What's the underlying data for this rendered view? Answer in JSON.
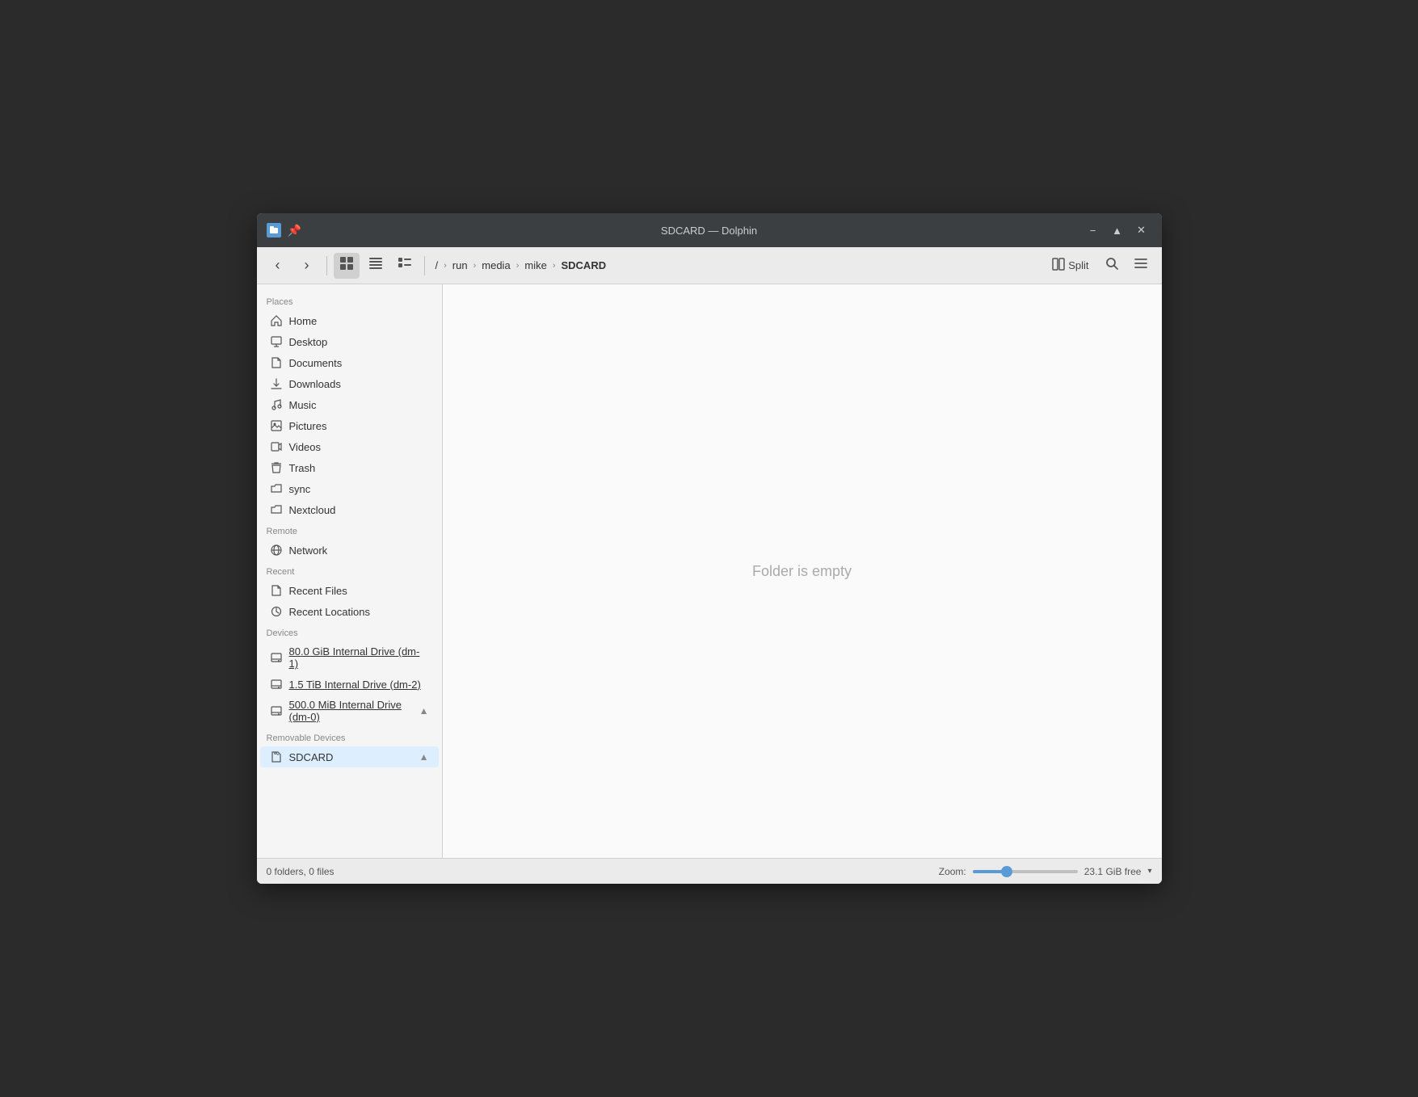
{
  "window": {
    "title": "SDCARD — Dolphin"
  },
  "titlebar": {
    "minimize_label": "−",
    "maximize_label": "▲",
    "close_label": "✕"
  },
  "toolbar": {
    "back_label": "‹",
    "forward_label": "›",
    "view_icons_label": "⊞",
    "view_compact_label": "▤",
    "view_details_label": "⊟",
    "split_label": "Split",
    "search_label": "🔍",
    "menu_label": "≡"
  },
  "breadcrumb": {
    "items": [
      {
        "label": "/",
        "id": "root"
      },
      {
        "label": "run",
        "id": "run"
      },
      {
        "label": "media",
        "id": "media"
      },
      {
        "label": "mike",
        "id": "mike"
      },
      {
        "label": "SDCARD",
        "id": "sdcard",
        "current": true
      }
    ]
  },
  "sidebar": {
    "places_header": "Places",
    "places_items": [
      {
        "id": "home",
        "label": "Home",
        "icon": "🏠"
      },
      {
        "id": "desktop",
        "label": "Desktop",
        "icon": "🖥"
      },
      {
        "id": "documents",
        "label": "Documents",
        "icon": "📄"
      },
      {
        "id": "downloads",
        "label": "Downloads",
        "icon": "📥"
      },
      {
        "id": "music",
        "label": "Music",
        "icon": "🎵"
      },
      {
        "id": "pictures",
        "label": "Pictures",
        "icon": "🖼"
      },
      {
        "id": "videos",
        "label": "Videos",
        "icon": "🎬"
      },
      {
        "id": "trash",
        "label": "Trash",
        "icon": "🗑"
      },
      {
        "id": "sync",
        "label": "sync",
        "icon": "📁"
      },
      {
        "id": "nextcloud",
        "label": "Nextcloud",
        "icon": "📁"
      }
    ],
    "remote_header": "Remote",
    "remote_items": [
      {
        "id": "network",
        "label": "Network",
        "icon": "🌐"
      }
    ],
    "recent_header": "Recent",
    "recent_items": [
      {
        "id": "recent-files",
        "label": "Recent Files",
        "icon": "📄"
      },
      {
        "id": "recent-locations",
        "label": "Recent Locations",
        "icon": "🕐"
      }
    ],
    "devices_header": "Devices",
    "devices_items": [
      {
        "id": "dm1",
        "label": "80.0 GiB Internal Drive (dm-1)",
        "icon": "💾",
        "eject": false
      },
      {
        "id": "dm2",
        "label": "1.5 TiB Internal Drive (dm-2)",
        "icon": "💾",
        "eject": false
      },
      {
        "id": "dm0",
        "label": "500.0 MiB Internal Drive (dm-0)",
        "icon": "💾",
        "eject": true
      }
    ],
    "removable_header": "Removable Devices",
    "removable_items": [
      {
        "id": "sdcard",
        "label": "SDCARD",
        "icon": "💳",
        "eject": true
      }
    ]
  },
  "file_area": {
    "empty_message": "Folder is empty"
  },
  "statusbar": {
    "info": "0 folders, 0 files",
    "zoom_label": "Zoom:",
    "zoom_value": "30",
    "free_space": "23.1 GiB free"
  }
}
